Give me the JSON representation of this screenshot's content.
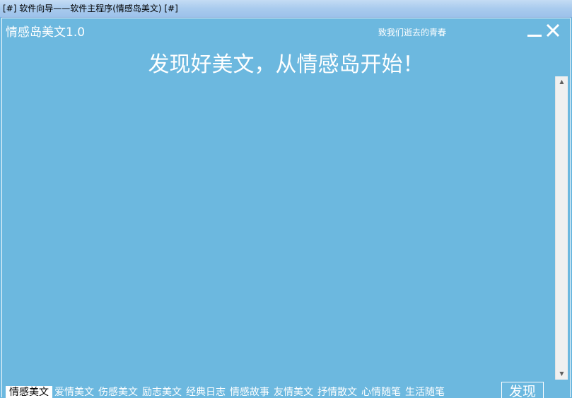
{
  "os_window": {
    "title": "[#] 软件向导——软件主程序(情感岛美文) [#]"
  },
  "app": {
    "title": "情感岛美文1.0",
    "tagline": "致我们逝去的青春",
    "headline": "发现好美文，从情感岛开始！",
    "minimize_icon": "minimize-icon",
    "close_icon": "close-icon"
  },
  "tabs": [
    {
      "label": "情感美文",
      "active": true
    },
    {
      "label": "爱情美文",
      "active": false
    },
    {
      "label": "伤感美文",
      "active": false
    },
    {
      "label": "励志美文",
      "active": false
    },
    {
      "label": "经典日志",
      "active": false
    },
    {
      "label": "情感故事",
      "active": false
    },
    {
      "label": "友情美文",
      "active": false
    },
    {
      "label": "抒情散文",
      "active": false
    },
    {
      "label": "心情随笔",
      "active": false
    },
    {
      "label": "生活随笔",
      "active": false
    }
  ],
  "discover_button": {
    "label": "发现"
  },
  "scrollbar": {
    "up_icon": "scroll-up-arrow-icon",
    "down_icon": "scroll-down-arrow-icon"
  },
  "colors": {
    "background": "#6cb8df",
    "titlebar": "#a9cbee",
    "text": "#ffffff"
  }
}
